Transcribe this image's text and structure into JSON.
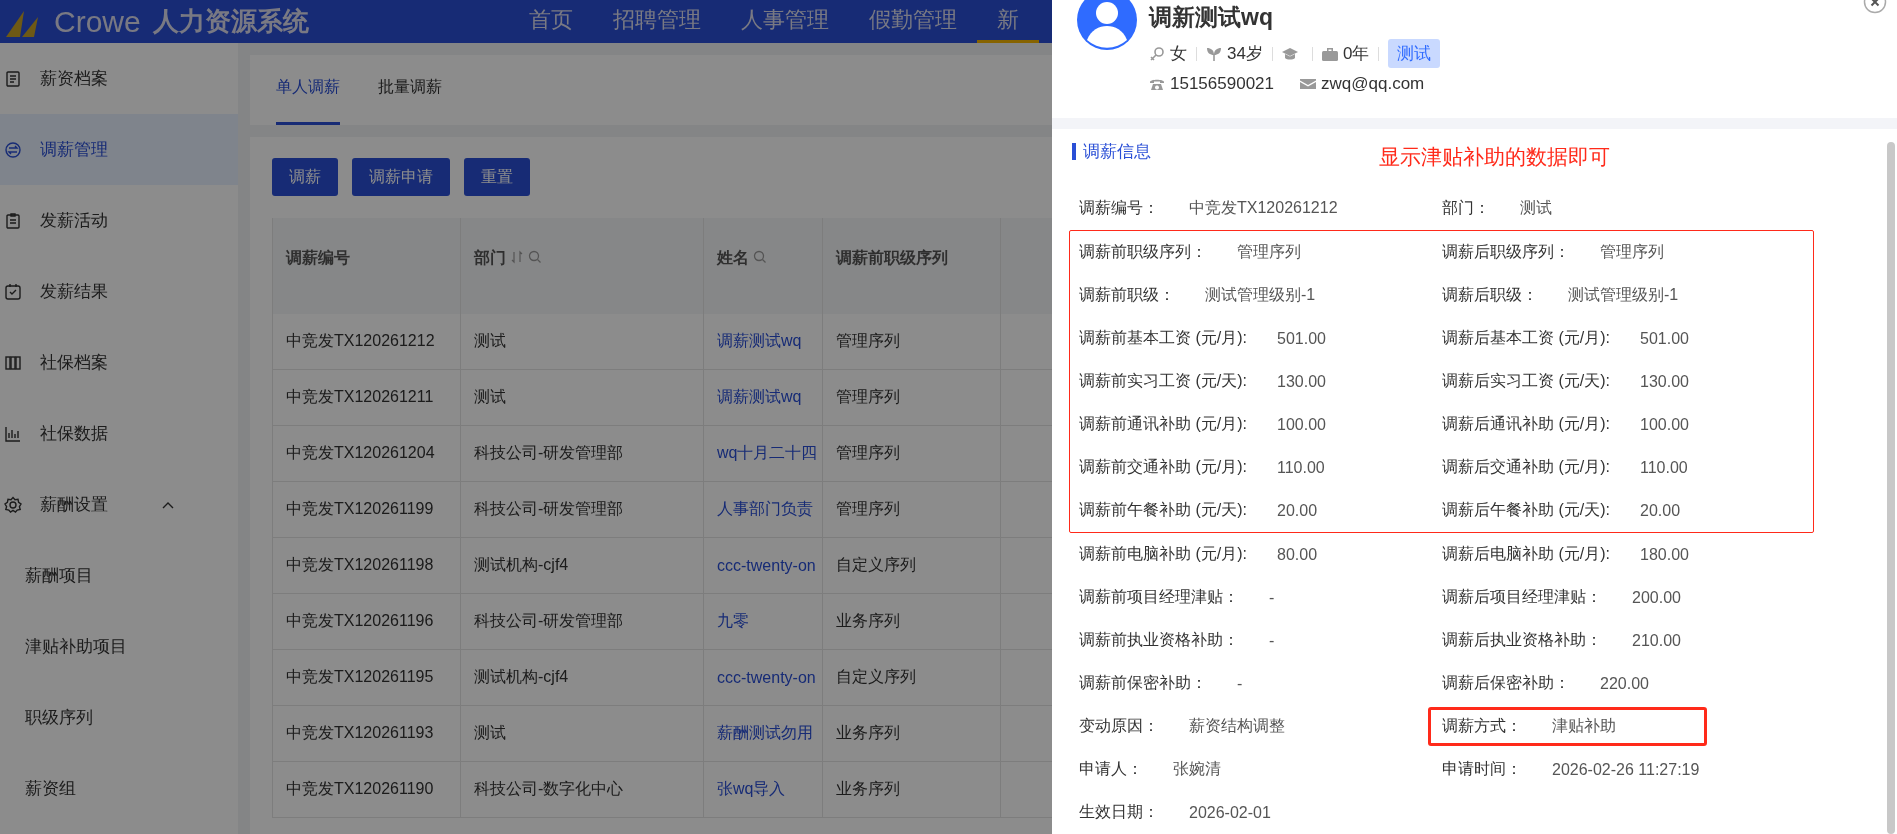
{
  "header": {
    "logo_text": "Crowe",
    "system_name": "人力资源系统",
    "nav": [
      {
        "label": "首页",
        "selected": false
      },
      {
        "label": "招聘管理",
        "selected": false
      },
      {
        "label": "人事管理",
        "selected": false
      },
      {
        "label": "假勤管理",
        "selected": false
      },
      {
        "label": "新",
        "selected": true
      }
    ]
  },
  "sidebar": {
    "items": [
      {
        "label": "薪资档案",
        "selected": false
      },
      {
        "label": "调薪管理",
        "selected": true
      },
      {
        "label": "发薪活动",
        "selected": false
      },
      {
        "label": "发薪结果",
        "selected": false
      },
      {
        "label": "社保档案",
        "selected": false
      },
      {
        "label": "社保数据",
        "selected": false
      },
      {
        "label": "薪酬设置",
        "selected": false,
        "expanded": true,
        "children": [
          {
            "label": "薪酬项目",
            "selected": false
          },
          {
            "label": "津贴补助项目",
            "selected": false
          },
          {
            "label": "职级序列",
            "selected": false
          },
          {
            "label": "薪资组",
            "selected": false
          }
        ]
      }
    ]
  },
  "tabs": [
    {
      "label": "单人调薪",
      "selected": true
    },
    {
      "label": "批量调薪",
      "selected": false
    }
  ],
  "buttons": [
    "调薪",
    "调薪申请",
    "重置"
  ],
  "table": {
    "columns": [
      {
        "label": "调薪编号",
        "kind": "text"
      },
      {
        "label": "部门",
        "sortable": true,
        "searchable": true,
        "kind": "text"
      },
      {
        "label": "姓名",
        "searchable": true,
        "kind": "link"
      },
      {
        "label": "调薪前职级序列",
        "kind": "text"
      }
    ],
    "rows": [
      [
        "中竞发TX120261212",
        "测试",
        "调薪测试wq",
        "管理序列"
      ],
      [
        "中竞发TX120261211",
        "测试",
        "调薪测试wq",
        "管理序列"
      ],
      [
        "中竞发TX120261204",
        "科技公司-研发管理部",
        "wq十月二十四",
        "管理序列"
      ],
      [
        "中竞发TX120261199",
        "科技公司-研发管理部",
        "人事部门负责",
        "管理序列"
      ],
      [
        "中竞发TX120261198",
        "测试机构-cjf4",
        "ccc-twenty-on",
        "自定义序列"
      ],
      [
        "中竞发TX120261196",
        "科技公司-研发管理部",
        "九零",
        "业务序列"
      ],
      [
        "中竞发TX120261195",
        "测试机构-cjf4",
        "ccc-twenty-on",
        "自定义序列"
      ],
      [
        "中竞发TX120261193",
        "测试",
        "薪酬测试勿用",
        "业务序列"
      ],
      [
        "中竞发TX120261190",
        "科技公司-数字化中心",
        "张wq导入",
        "业务序列"
      ]
    ]
  },
  "drawer": {
    "name": "调新测试wq",
    "gender": "女",
    "age": "34岁",
    "experience": "0年",
    "tag": "测试",
    "phone": "15156590021",
    "email": "zwq@qq.com",
    "section_title": "调薪信息",
    "annotation": "显示津贴补助的数据即可",
    "groups": [
      {
        "rows": [
          [
            {
              "label": "调薪编号：",
              "value": "中竞发TX120261212"
            },
            {
              "label": "部门：",
              "value": "测试"
            }
          ]
        ]
      },
      {
        "framed": true,
        "rows": [
          [
            {
              "label": "调薪前职级序列：",
              "value": "管理序列"
            },
            {
              "label": "调薪后职级序列：",
              "value": "管理序列"
            }
          ],
          [
            {
              "label": "调薪前职级：",
              "value": "测试管理级别-1"
            },
            {
              "label": "调薪后职级：",
              "value": "测试管理级别-1"
            }
          ],
          [
            {
              "label": "调薪前基本工资 (元/月):",
              "value": "501.00"
            },
            {
              "label": "调薪后基本工资 (元/月):",
              "value": "501.00"
            }
          ],
          [
            {
              "label": "调薪前实习工资 (元/天):",
              "value": "130.00"
            },
            {
              "label": "调薪后实习工资 (元/天):",
              "value": "130.00"
            }
          ],
          [
            {
              "label": "调薪前通讯补助 (元/月):",
              "value": "100.00"
            },
            {
              "label": "调薪后通讯补助 (元/月):",
              "value": "100.00"
            }
          ],
          [
            {
              "label": "调薪前交通补助 (元/月):",
              "value": "110.00"
            },
            {
              "label": "调薪后交通补助 (元/月):",
              "value": "110.00"
            }
          ],
          [
            {
              "label": "调薪前午餐补助 (元/天):",
              "value": "20.00"
            },
            {
              "label": "调薪后午餐补助 (元/天):",
              "value": "20.00"
            }
          ]
        ]
      },
      {
        "rows": [
          [
            {
              "label": "调薪前电脑补助 (元/月):",
              "value": "80.00"
            },
            {
              "label": "调薪后电脑补助 (元/月):",
              "value": "180.00"
            }
          ],
          [
            {
              "label": "调薪前项目经理津贴：",
              "value": "-"
            },
            {
              "label": "调薪后项目经理津贴：",
              "value": "200.00"
            }
          ],
          [
            {
              "label": "调薪前执业资格补助：",
              "value": "-"
            },
            {
              "label": "调薪后执业资格补助：",
              "value": "210.00"
            }
          ],
          [
            {
              "label": "调薪前保密补助：",
              "value": "-"
            },
            {
              "label": "调薪后保密补助：",
              "value": "220.00"
            }
          ],
          [
            {
              "label": "变动原因：",
              "value": "薪资结构调整"
            },
            {
              "label": "调薪方式：",
              "value": "津贴补助",
              "framed": true
            }
          ],
          [
            {
              "label": "申请人：",
              "value": "张婉清"
            },
            {
              "label": "申请时间：",
              "value": "2026-02-26 11:27:19"
            }
          ],
          [
            {
              "label": "生效日期：",
              "value": "2026-02-01"
            }
          ]
        ]
      }
    ]
  }
}
